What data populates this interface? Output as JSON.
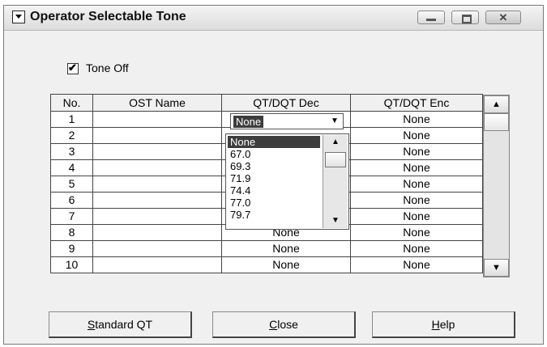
{
  "window": {
    "title": "Operator Selectable Tone",
    "controls": [
      "minimize",
      "maximize",
      "close"
    ],
    "close_glyph": "✕"
  },
  "tone_off": {
    "label": "Tone Off",
    "checked": true,
    "mark": "✔"
  },
  "table": {
    "headers": [
      "No.",
      "OST Name",
      "QT/DQT Dec",
      "QT/DQT Enc"
    ],
    "rows": [
      {
        "no": "1",
        "name": "",
        "dec": "None",
        "enc": "None"
      },
      {
        "no": "2",
        "name": "",
        "dec": "",
        "enc": "None"
      },
      {
        "no": "3",
        "name": "",
        "dec": "",
        "enc": "None"
      },
      {
        "no": "4",
        "name": "",
        "dec": "",
        "enc": "None"
      },
      {
        "no": "5",
        "name": "",
        "dec": "",
        "enc": "None"
      },
      {
        "no": "6",
        "name": "",
        "dec": "",
        "enc": "None"
      },
      {
        "no": "7",
        "name": "",
        "dec": "",
        "enc": "None"
      },
      {
        "no": "8",
        "name": "",
        "dec": "None",
        "enc": "None"
      },
      {
        "no": "9",
        "name": "",
        "dec": "None",
        "enc": "None"
      },
      {
        "no": "10",
        "name": "",
        "dec": "None",
        "enc": "None"
      }
    ]
  },
  "dec_combo": {
    "value": "None",
    "options": [
      "None",
      "67.0",
      "69.3",
      "71.9",
      "74.4",
      "77.0",
      "79.7"
    ],
    "selected_index": 0
  },
  "icons": {
    "scroll_up": "▲",
    "scroll_down": "▼",
    "combo_arrow": "▼"
  },
  "buttons": {
    "standard_qt": {
      "mnemonic": "S",
      "rest": "tandard QT"
    },
    "close": {
      "mnemonic": "C",
      "rest": "lose"
    },
    "help": {
      "mnemonic": "H",
      "rest": "elp"
    }
  },
  "colors": {
    "window_bg": "#f0f0f0",
    "selection": "#3d3d3d"
  }
}
